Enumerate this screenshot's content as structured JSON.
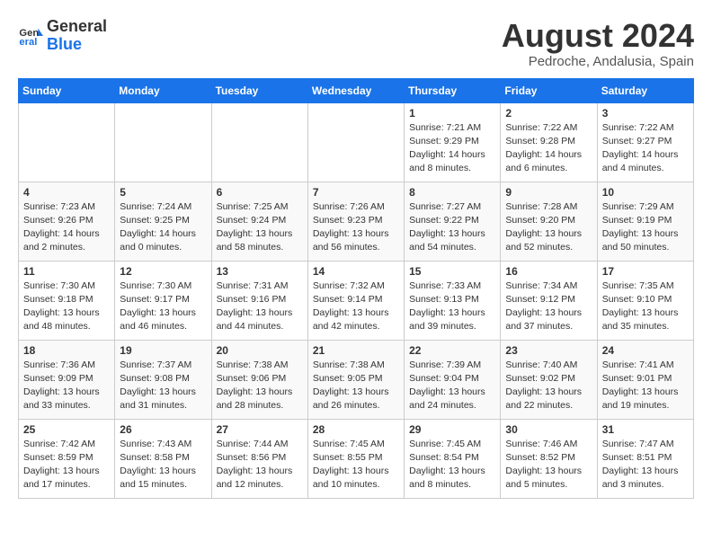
{
  "logo": {
    "line1": "General",
    "line2": "Blue"
  },
  "title": "August 2024",
  "location": "Pedroche, Andalusia, Spain",
  "days_of_week": [
    "Sunday",
    "Monday",
    "Tuesday",
    "Wednesday",
    "Thursday",
    "Friday",
    "Saturday"
  ],
  "weeks": [
    [
      {
        "day": "",
        "info": ""
      },
      {
        "day": "",
        "info": ""
      },
      {
        "day": "",
        "info": ""
      },
      {
        "day": "",
        "info": ""
      },
      {
        "day": "1",
        "info": "Sunrise: 7:21 AM\nSunset: 9:29 PM\nDaylight: 14 hours\nand 8 minutes."
      },
      {
        "day": "2",
        "info": "Sunrise: 7:22 AM\nSunset: 9:28 PM\nDaylight: 14 hours\nand 6 minutes."
      },
      {
        "day": "3",
        "info": "Sunrise: 7:22 AM\nSunset: 9:27 PM\nDaylight: 14 hours\nand 4 minutes."
      }
    ],
    [
      {
        "day": "4",
        "info": "Sunrise: 7:23 AM\nSunset: 9:26 PM\nDaylight: 14 hours\nand 2 minutes."
      },
      {
        "day": "5",
        "info": "Sunrise: 7:24 AM\nSunset: 9:25 PM\nDaylight: 14 hours\nand 0 minutes."
      },
      {
        "day": "6",
        "info": "Sunrise: 7:25 AM\nSunset: 9:24 PM\nDaylight: 13 hours\nand 58 minutes."
      },
      {
        "day": "7",
        "info": "Sunrise: 7:26 AM\nSunset: 9:23 PM\nDaylight: 13 hours\nand 56 minutes."
      },
      {
        "day": "8",
        "info": "Sunrise: 7:27 AM\nSunset: 9:22 PM\nDaylight: 13 hours\nand 54 minutes."
      },
      {
        "day": "9",
        "info": "Sunrise: 7:28 AM\nSunset: 9:20 PM\nDaylight: 13 hours\nand 52 minutes."
      },
      {
        "day": "10",
        "info": "Sunrise: 7:29 AM\nSunset: 9:19 PM\nDaylight: 13 hours\nand 50 minutes."
      }
    ],
    [
      {
        "day": "11",
        "info": "Sunrise: 7:30 AM\nSunset: 9:18 PM\nDaylight: 13 hours\nand 48 minutes."
      },
      {
        "day": "12",
        "info": "Sunrise: 7:30 AM\nSunset: 9:17 PM\nDaylight: 13 hours\nand 46 minutes."
      },
      {
        "day": "13",
        "info": "Sunrise: 7:31 AM\nSunset: 9:16 PM\nDaylight: 13 hours\nand 44 minutes."
      },
      {
        "day": "14",
        "info": "Sunrise: 7:32 AM\nSunset: 9:14 PM\nDaylight: 13 hours\nand 42 minutes."
      },
      {
        "day": "15",
        "info": "Sunrise: 7:33 AM\nSunset: 9:13 PM\nDaylight: 13 hours\nand 39 minutes."
      },
      {
        "day": "16",
        "info": "Sunrise: 7:34 AM\nSunset: 9:12 PM\nDaylight: 13 hours\nand 37 minutes."
      },
      {
        "day": "17",
        "info": "Sunrise: 7:35 AM\nSunset: 9:10 PM\nDaylight: 13 hours\nand 35 minutes."
      }
    ],
    [
      {
        "day": "18",
        "info": "Sunrise: 7:36 AM\nSunset: 9:09 PM\nDaylight: 13 hours\nand 33 minutes."
      },
      {
        "day": "19",
        "info": "Sunrise: 7:37 AM\nSunset: 9:08 PM\nDaylight: 13 hours\nand 31 minutes."
      },
      {
        "day": "20",
        "info": "Sunrise: 7:38 AM\nSunset: 9:06 PM\nDaylight: 13 hours\nand 28 minutes."
      },
      {
        "day": "21",
        "info": "Sunrise: 7:38 AM\nSunset: 9:05 PM\nDaylight: 13 hours\nand 26 minutes."
      },
      {
        "day": "22",
        "info": "Sunrise: 7:39 AM\nSunset: 9:04 PM\nDaylight: 13 hours\nand 24 minutes."
      },
      {
        "day": "23",
        "info": "Sunrise: 7:40 AM\nSunset: 9:02 PM\nDaylight: 13 hours\nand 22 minutes."
      },
      {
        "day": "24",
        "info": "Sunrise: 7:41 AM\nSunset: 9:01 PM\nDaylight: 13 hours\nand 19 minutes."
      }
    ],
    [
      {
        "day": "25",
        "info": "Sunrise: 7:42 AM\nSunset: 8:59 PM\nDaylight: 13 hours\nand 17 minutes."
      },
      {
        "day": "26",
        "info": "Sunrise: 7:43 AM\nSunset: 8:58 PM\nDaylight: 13 hours\nand 15 minutes."
      },
      {
        "day": "27",
        "info": "Sunrise: 7:44 AM\nSunset: 8:56 PM\nDaylight: 13 hours\nand 12 minutes."
      },
      {
        "day": "28",
        "info": "Sunrise: 7:45 AM\nSunset: 8:55 PM\nDaylight: 13 hours\nand 10 minutes."
      },
      {
        "day": "29",
        "info": "Sunrise: 7:45 AM\nSunset: 8:54 PM\nDaylight: 13 hours\nand 8 minutes."
      },
      {
        "day": "30",
        "info": "Sunrise: 7:46 AM\nSunset: 8:52 PM\nDaylight: 13 hours\nand 5 minutes."
      },
      {
        "day": "31",
        "info": "Sunrise: 7:47 AM\nSunset: 8:51 PM\nDaylight: 13 hours\nand 3 minutes."
      }
    ]
  ]
}
